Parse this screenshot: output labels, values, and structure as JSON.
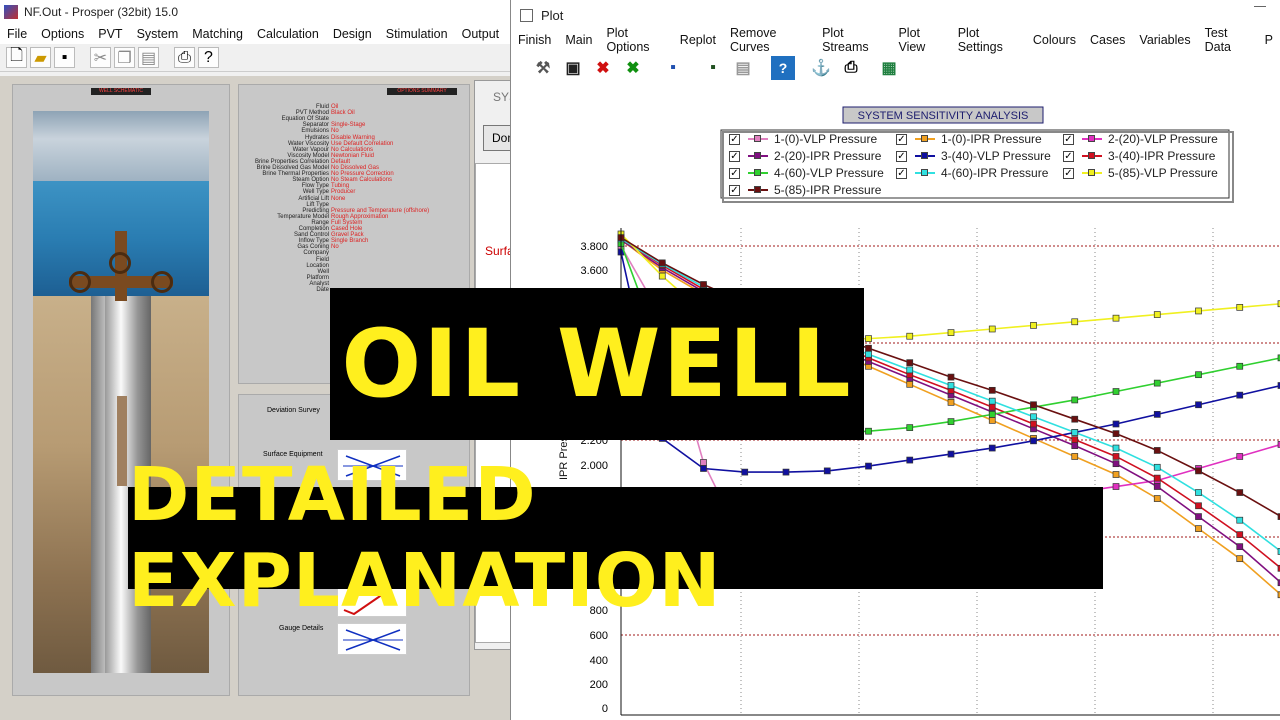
{
  "left_app": {
    "title": "NF.Out - Prosper (32bit) 15.0",
    "menu": [
      "File",
      "Options",
      "PVT",
      "System",
      "Matching",
      "Calculation",
      "Design",
      "Stimulation",
      "Output",
      "Ur"
    ],
    "well_schematic_label": "WELL SCHEMATIC",
    "options_summary_label": "OPTIONS SUMMARY",
    "sys_tab_label": "SYS",
    "done_button": "Don",
    "surface_label": "Surfa",
    "summary": [
      {
        "k": "Fluid",
        "v": "Oil"
      },
      {
        "k": "PVT Method",
        "v": "Black Oil"
      },
      {
        "k": "Equation Of State",
        "v": ""
      },
      {
        "k": "Separator",
        "v": "Single-Stage"
      },
      {
        "k": "Emulsions",
        "v": "No"
      },
      {
        "k": "Hydrates",
        "v": "Disable Warning"
      },
      {
        "k": "Water Viscosity",
        "v": "Use Default Correlation"
      },
      {
        "k": "Water Vapour",
        "v": "No Calculations"
      },
      {
        "k": "Viscosity Model",
        "v": "Newtonian Fluid"
      },
      {
        "k": "Brine Properties Correlation",
        "v": "Default"
      },
      {
        "k": "Brine Dissolved Gas Model",
        "v": "No Dissolved Gas"
      },
      {
        "k": "Brine Thermal Properties",
        "v": "No Pressure Correction"
      },
      {
        "k": "Steam Option",
        "v": "No Steam Calculations"
      },
      {
        "k": "Flow Type",
        "v": "Tubing"
      },
      {
        "k": "Well Type",
        "v": "Producer"
      },
      {
        "k": "Artificial Lift",
        "v": "None"
      },
      {
        "k": "Lift Type",
        "v": ""
      },
      {
        "k": "Predicting",
        "v": "Pressure and Temperature (offshore)"
      },
      {
        "k": "Temperature Model",
        "v": "Rough Approximation"
      },
      {
        "k": "Range",
        "v": "Full System"
      },
      {
        "k": "Completion",
        "v": "Cased Hole"
      },
      {
        "k": "Sand Control",
        "v": "Gravel Pack"
      },
      {
        "k": "Inflow Type",
        "v": "Single Branch"
      },
      {
        "k": "Gas Coning",
        "v": "No"
      },
      {
        "k": "Company",
        "v": ""
      },
      {
        "k": "Field",
        "v": ""
      },
      {
        "k": "Location",
        "v": ""
      },
      {
        "k": "Well",
        "v": ""
      },
      {
        "k": "Platform",
        "v": ""
      },
      {
        "k": "Analyst",
        "v": ""
      },
      {
        "k": "Date",
        "v": ""
      }
    ],
    "equipment": [
      "Deviation Survey",
      "Surface Equipment",
      "Gauge Details"
    ]
  },
  "plot_window": {
    "title": "Plot",
    "menu": [
      "Finish",
      "Main",
      "Plot Options",
      "Replot",
      "Remove Curves",
      "Plot Streams",
      "Plot View",
      "Plot Settings",
      "Colours",
      "Cases",
      "Variables",
      "Test Data",
      "P"
    ]
  },
  "chart_data": {
    "type": "line",
    "title": "SYSTEM SENSITIVITY ANALYSIS",
    "ylabel": "IPR Pres",
    "yticks": [
      "3.800",
      "3.600",
      "2.200",
      "2.000",
      "800",
      "600",
      "400",
      "200",
      "0"
    ],
    "ylim": [
      0,
      4000
    ],
    "grid": true,
    "legend_position": "top",
    "x": [
      0,
      1,
      2,
      3,
      4,
      5,
      6,
      7,
      8,
      9,
      10,
      11,
      12,
      13,
      14,
      15,
      16
    ],
    "series": [
      {
        "name": "1-(0)-VLP Pressure",
        "color": "#e080c0",
        "values": [
          3900,
          3300,
          2100,
          1400,
          null,
          null,
          null,
          null,
          null,
          null,
          null,
          null,
          null,
          null,
          null,
          null,
          null
        ]
      },
      {
        "name": "1-(0)-IPR Pressure",
        "color": "#f0a020",
        "values": [
          3950,
          3700,
          3500,
          3350,
          3200,
          3050,
          2900,
          2750,
          2600,
          2450,
          2300,
          2150,
          2000,
          1800,
          1550,
          1300,
          1000
        ]
      },
      {
        "name": "2-(20)-VLP Pressure",
        "color": "#e030c0",
        "values": [
          null,
          null,
          null,
          null,
          null,
          null,
          null,
          null,
          null,
          null,
          null,
          1850,
          1900,
          1950,
          2050,
          2150,
          2250
        ]
      },
      {
        "name": "2-(20)-IPR Pressure",
        "color": "#801080",
        "values": [
          3950,
          3720,
          3520,
          3370,
          3220,
          3080,
          2940,
          2800,
          2660,
          2520,
          2380,
          2240,
          2090,
          1900,
          1650,
          1400,
          1100
        ]
      },
      {
        "name": "3-(40)-VLP Pressure",
        "color": "#1010a0",
        "values": [
          3850,
          2300,
          2050,
          2020,
          2020,
          2030,
          2070,
          2120,
          2170,
          2220,
          2280,
          2350,
          2420,
          2500,
          2580,
          2660,
          2740
        ]
      },
      {
        "name": "3-(40)-IPR Pressure",
        "color": "#d01020",
        "values": [
          3960,
          3740,
          3540,
          3390,
          3250,
          3110,
          2970,
          2830,
          2700,
          2560,
          2420,
          2290,
          2150,
          1970,
          1740,
          1500,
          1220
        ]
      },
      {
        "name": "4-(60)-VLP Pressure",
        "color": "#30d030",
        "values": [
          3920,
          3000,
          2500,
          2350,
          2330,
          2340,
          2360,
          2390,
          2440,
          2500,
          2560,
          2620,
          2690,
          2760,
          2830,
          2900,
          2970
        ]
      },
      {
        "name": "4-(60)-IPR Pressure",
        "color": "#30e0e0",
        "values": [
          3960,
          3750,
          3560,
          3410,
          3270,
          3130,
          3000,
          2870,
          2740,
          2610,
          2480,
          2350,
          2220,
          2060,
          1850,
          1620,
          1360
        ]
      },
      {
        "name": "5-(85)-VLP Pressure",
        "color": "#f0f020",
        "values": [
          4000,
          3650,
          3350,
          3180,
          3120,
          3120,
          3130,
          3150,
          3180,
          3210,
          3240,
          3270,
          3300,
          3330,
          3360,
          3390,
          3420
        ]
      },
      {
        "name": "5-(85)-IPR Pressure",
        "color": "#6a1010",
        "values": [
          3970,
          3760,
          3580,
          3430,
          3300,
          3170,
          3050,
          2930,
          2810,
          2700,
          2580,
          2460,
          2340,
          2200,
          2030,
          1850,
          1650
        ]
      }
    ]
  },
  "overlay": {
    "title_line1": "OIL WELL",
    "title_line2": "DETAILED EXPLANATION"
  }
}
